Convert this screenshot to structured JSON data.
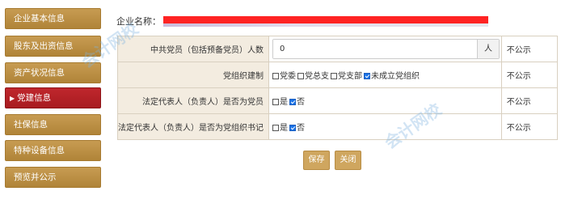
{
  "sidebar": {
    "items": [
      {
        "label": "企业基本信息",
        "active": false
      },
      {
        "label": "股东及出资信息",
        "active": false
      },
      {
        "label": "资产状况信息",
        "active": false
      },
      {
        "label": "党建信息",
        "active": true
      },
      {
        "label": "社保信息",
        "active": false
      },
      {
        "label": "特种设备信息",
        "active": false
      },
      {
        "label": "预览并公示",
        "active": false
      }
    ],
    "active_arrow": "▶"
  },
  "company": {
    "label": "企业名称："
  },
  "form": {
    "rows": [
      {
        "label": "中共党员（包括预备党员）人数",
        "input_value": "0",
        "unit": "人",
        "public": "不公示"
      },
      {
        "label": "党组织建制",
        "options": [
          "党委",
          "党总支",
          "党支部",
          "未成立党组织"
        ],
        "checked": [
          false,
          false,
          false,
          true
        ],
        "public": "不公示"
      },
      {
        "label": "法定代表人（负责人）是否为党员",
        "options": [
          "是",
          "否"
        ],
        "checked": [
          false,
          true
        ],
        "public": "不公示"
      },
      {
        "label": "法定代表人（负责人）是否为党组织书记",
        "options": [
          "是",
          "否"
        ],
        "checked": [
          false,
          true
        ],
        "public": "不公示"
      }
    ]
  },
  "actions": {
    "save_label": "保存",
    "close_label": "关闭"
  },
  "watermark": {
    "text": "会计网校",
    "color": "#7fb4e0"
  },
  "colors": {
    "sidebar_gold": "#b08438",
    "active_red": "#c0272d",
    "button_gold": "#cfa65f",
    "label_bg": "#f3ece0"
  }
}
